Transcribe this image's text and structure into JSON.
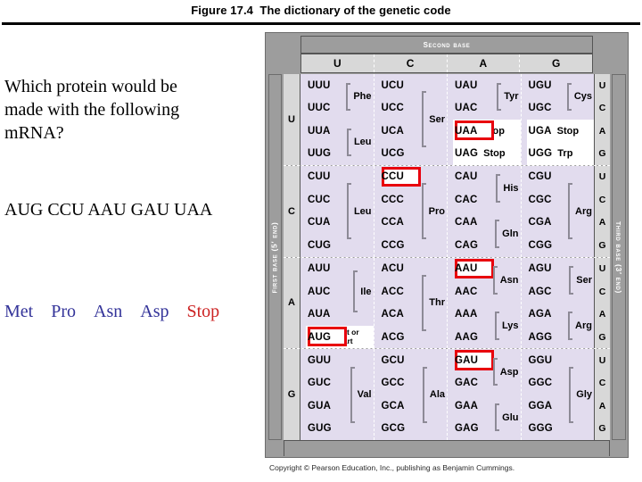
{
  "title": "Figure 17.4  The dictionary of the genetic code",
  "question": {
    "lines": [
      "Which protein would be",
      "made with the following",
      "mRNA?"
    ],
    "mrna": "AUG CCU AAU GAU UAA",
    "answer": [
      {
        "text": "Met",
        "color": "#333399"
      },
      {
        "text": "Pro",
        "color": "#333399"
      },
      {
        "text": "Asn",
        "color": "#333399"
      },
      {
        "text": "Asp",
        "color": "#333399"
      },
      {
        "text": "Stop",
        "color": "#cc2222"
      }
    ]
  },
  "table": {
    "second_base_label": "Second base",
    "first_base_label": "First base (5′ end)",
    "third_base_label": "Third base (3′ end)",
    "second_base_columns": [
      "U",
      "C",
      "A",
      "G"
    ],
    "third_base_letters": [
      "U",
      "C",
      "A",
      "G"
    ],
    "highlight_color": "#e8000d",
    "highlighted_codons": [
      "UAA",
      "CCU",
      "AAU",
      "AUG",
      "GAU"
    ],
    "rows": [
      {
        "first_base": "U",
        "columns": [
          {
            "codons": [
              "UUU",
              "UUC",
              "UUA",
              "UUG"
            ],
            "groups": [
              {
                "label": "Phe",
                "start": 0,
                "span": 2
              },
              {
                "label": "Leu",
                "start": 2,
                "span": 2
              }
            ]
          },
          {
            "codons": [
              "UCU",
              "UCC",
              "UCA",
              "UCG"
            ],
            "groups": [
              {
                "label": "Ser",
                "start": 0,
                "span": 4
              }
            ]
          },
          {
            "codons": [
              "UAU",
              "UAC",
              "UAA",
              "UAG"
            ],
            "groups": [
              {
                "label": "Tyr",
                "start": 0,
                "span": 2
              }
            ],
            "inline": [
              {
                "index": 2,
                "label": "Stop"
              },
              {
                "index": 3,
                "label": "Stop"
              }
            ]
          },
          {
            "codons": [
              "UGU",
              "UGC",
              "UGA",
              "UGG"
            ],
            "groups": [
              {
                "label": "Cys",
                "start": 0,
                "span": 2
              }
            ],
            "inline": [
              {
                "index": 2,
                "label": "Stop"
              },
              {
                "index": 3,
                "label": "Trp"
              }
            ]
          }
        ]
      },
      {
        "first_base": "C",
        "columns": [
          {
            "codons": [
              "CUU",
              "CUC",
              "CUA",
              "CUG"
            ],
            "groups": [
              {
                "label": "Leu",
                "start": 0,
                "span": 4
              }
            ]
          },
          {
            "codons": [
              "CCU",
              "CCC",
              "CCA",
              "CCG"
            ],
            "groups": [
              {
                "label": "Pro",
                "start": 0,
                "span": 4
              }
            ]
          },
          {
            "codons": [
              "CAU",
              "CAC",
              "CAA",
              "CAG"
            ],
            "groups": [
              {
                "label": "His",
                "start": 0,
                "span": 2
              },
              {
                "label": "Gln",
                "start": 2,
                "span": 2
              }
            ]
          },
          {
            "codons": [
              "CGU",
              "CGC",
              "CGA",
              "CGG"
            ],
            "groups": [
              {
                "label": "Arg",
                "start": 0,
                "span": 4
              }
            ]
          }
        ]
      },
      {
        "first_base": "A",
        "columns": [
          {
            "codons": [
              "AUU",
              "AUC",
              "AUA",
              "AUG"
            ],
            "groups": [
              {
                "label": "Ile",
                "start": 0,
                "span": 3
              }
            ],
            "inline": [
              {
                "index": 3,
                "label": "Met or start",
                "two_line": true
              }
            ]
          },
          {
            "codons": [
              "ACU",
              "ACC",
              "ACA",
              "ACG"
            ],
            "groups": [
              {
                "label": "Thr",
                "start": 0,
                "span": 4
              }
            ]
          },
          {
            "codons": [
              "AAU",
              "AAC",
              "AAA",
              "AAG"
            ],
            "groups": [
              {
                "label": "Asn",
                "start": 0,
                "span": 2
              },
              {
                "label": "Lys",
                "start": 2,
                "span": 2
              }
            ]
          },
          {
            "codons": [
              "AGU",
              "AGC",
              "AGA",
              "AGG"
            ],
            "groups": [
              {
                "label": "Ser",
                "start": 0,
                "span": 2
              },
              {
                "label": "Arg",
                "start": 2,
                "span": 2
              }
            ]
          }
        ]
      },
      {
        "first_base": "G",
        "columns": [
          {
            "codons": [
              "GUU",
              "GUC",
              "GUA",
              "GUG"
            ],
            "groups": [
              {
                "label": "Val",
                "start": 0,
                "span": 4
              }
            ]
          },
          {
            "codons": [
              "GCU",
              "GCC",
              "GCA",
              "GCG"
            ],
            "groups": [
              {
                "label": "Ala",
                "start": 0,
                "span": 4
              }
            ]
          },
          {
            "codons": [
              "GAU",
              "GAC",
              "GAA",
              "GAG"
            ],
            "groups": [
              {
                "label": "Asp",
                "start": 0,
                "span": 2
              },
              {
                "label": "Glu",
                "start": 2,
                "span": 2
              }
            ]
          },
          {
            "codons": [
              "GGU",
              "GGC",
              "GGA",
              "GGG"
            ],
            "groups": [
              {
                "label": "Gly",
                "start": 0,
                "span": 4
              }
            ]
          }
        ]
      }
    ]
  },
  "copyright": "Copyright © Pearson Education, Inc., publishing as Benjamin Cummings."
}
